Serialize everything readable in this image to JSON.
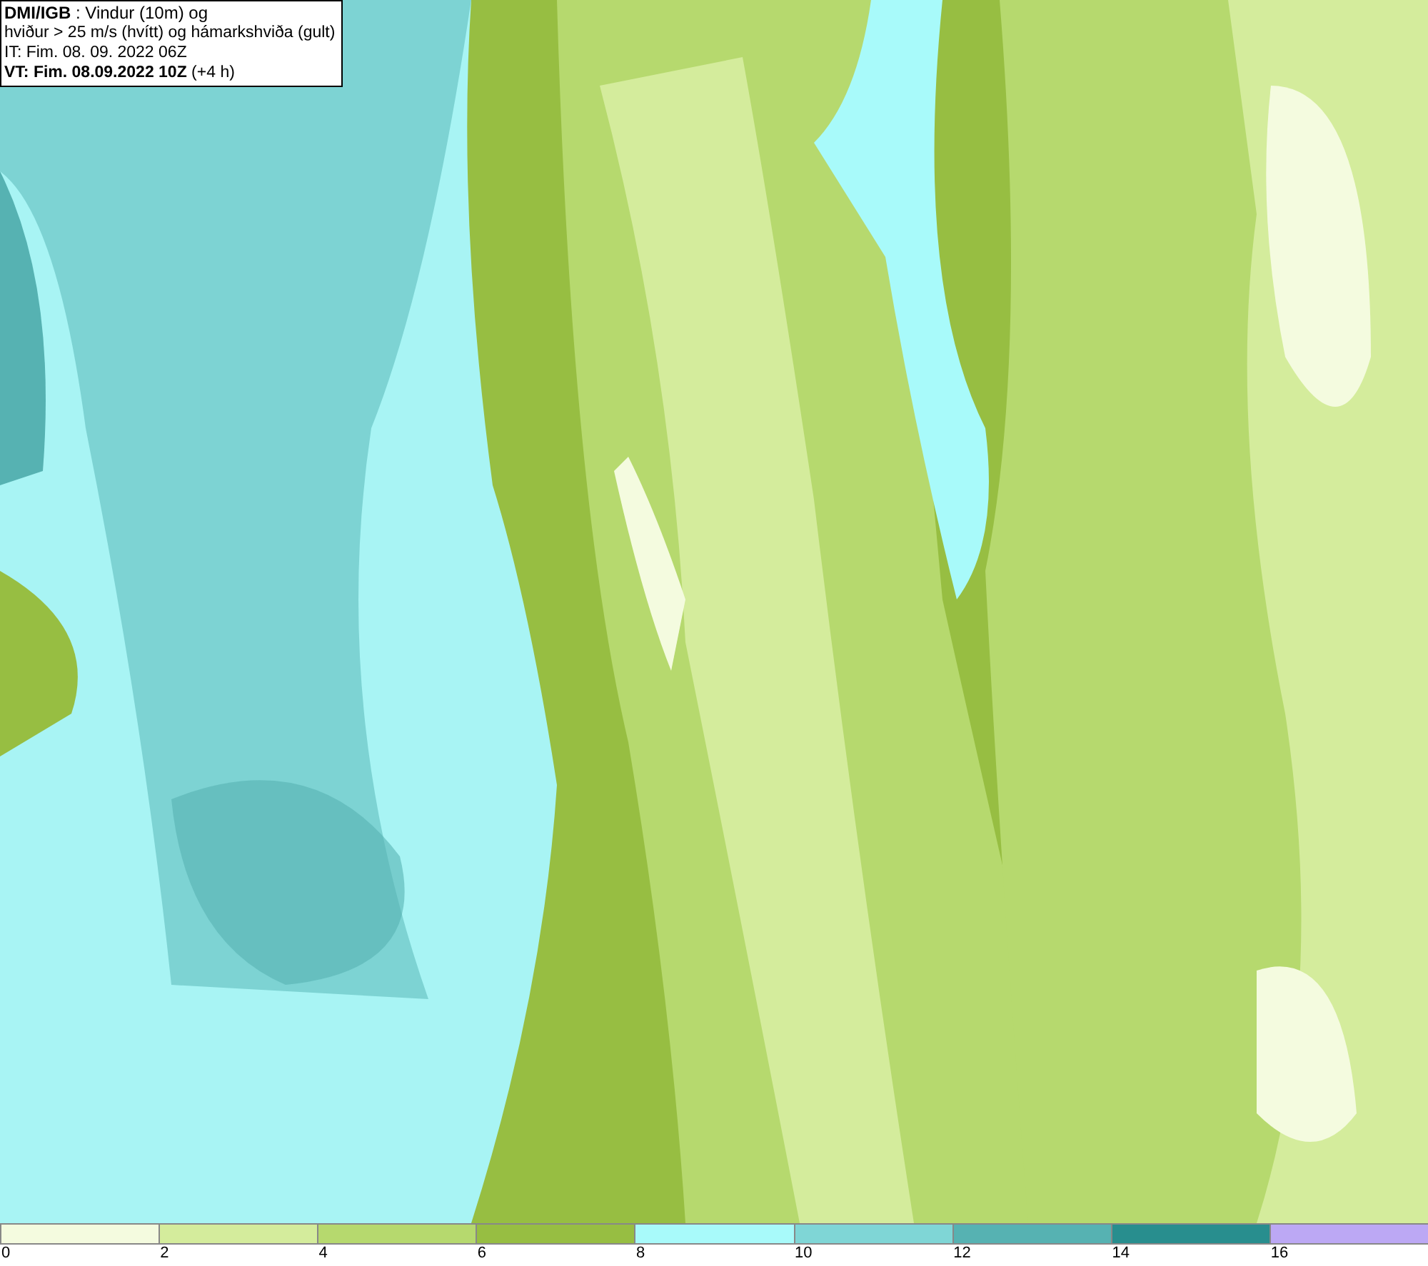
{
  "map": {
    "caption_lines": [
      "**DMI/IGB** : Vindur (10m) og",
      "hviður > 25 m/s (hvítt) og hámarkshviða (gult)",
      "IT: Fim. 08. 09. 2022 06Z",
      "**VT: Fim. 08.09.2022 10Z** (+4 h)"
    ]
  },
  "legend": [
    {
      "color": "#f4fbdf",
      "label": "0"
    },
    {
      "color": "#d4ec9c",
      "label": "2"
    },
    {
      "color": "#b6d96e",
      "label": "4"
    },
    {
      "color": "#97be42",
      "label": "6"
    },
    {
      "color": "#a8fafa",
      "label": "8"
    },
    {
      "color": "#7fd6d6",
      "label": "10"
    },
    {
      "color": "#56b2b2",
      "label": "12"
    },
    {
      "color": "#288e8e",
      "label": "14"
    },
    {
      "color": "#bca8f4",
      "label": "16"
    }
  ]
}
